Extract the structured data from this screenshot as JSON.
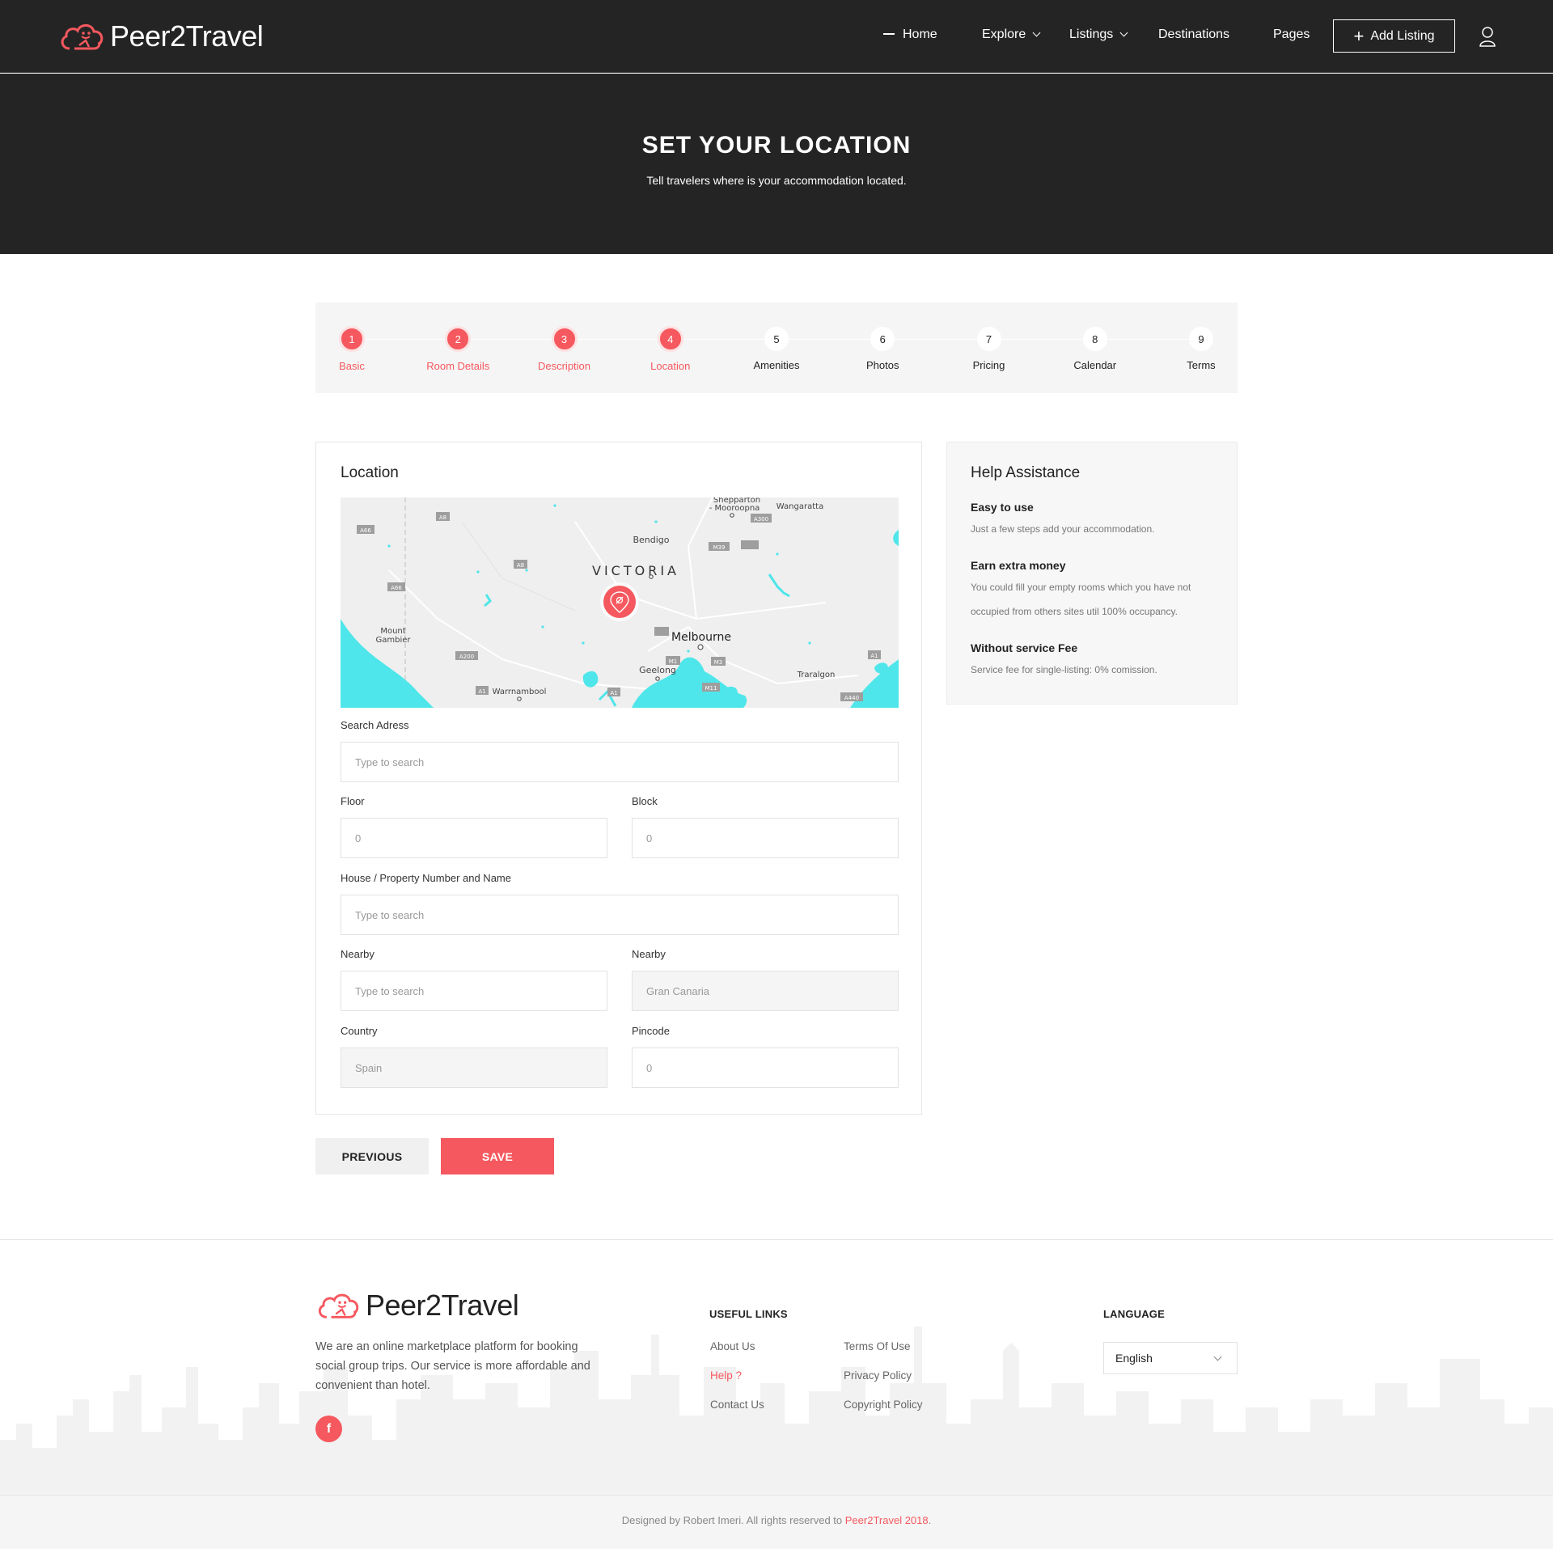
{
  "brand": {
    "name": "Peer2Travel",
    "accent": "#f5585e",
    "dark": "#242424"
  },
  "nav": {
    "home": "Home",
    "explore": "Explore",
    "listings": "Listings",
    "destinations": "Destinations",
    "pages": "Pages",
    "add_listing": "Add Listing"
  },
  "hero": {
    "title": "SET YOUR LOCATION",
    "subtitle": "Tell travelers where is your accommodation located."
  },
  "steps": [
    {
      "num": "1",
      "label": "Basic",
      "done": true
    },
    {
      "num": "2",
      "label": "Room Details",
      "done": true
    },
    {
      "num": "3",
      "label": "Description",
      "done": true
    },
    {
      "num": "4",
      "label": "Location",
      "done": true
    },
    {
      "num": "5",
      "label": "Amenities",
      "done": false
    },
    {
      "num": "6",
      "label": "Photos",
      "done": false
    },
    {
      "num": "7",
      "label": "Pricing",
      "done": false
    },
    {
      "num": "8",
      "label": "Calendar",
      "done": false
    },
    {
      "num": "9",
      "label": "Terms",
      "done": false
    }
  ],
  "location": {
    "title": "Location",
    "map": {
      "region": "VICTORIA",
      "places": [
        "Shepparton",
        "- Mooroopna",
        "Wangaratta",
        "Bendigo",
        "Melbourne",
        "Geelong",
        "Mount",
        "Gambier",
        "Warrnambool",
        "Traralgon"
      ],
      "roads": [
        "A66",
        "A8",
        "A8",
        "A66",
        "A300",
        "M39",
        "A200",
        "A1",
        "A1",
        "M1",
        "M3",
        "M11",
        "A1",
        "A440"
      ]
    },
    "fields": {
      "search_label": "Search Adress",
      "search_placeholder": "Type to search",
      "floor_label": "Floor",
      "floor_value": "0",
      "block_label": "Block",
      "block_value": "0",
      "house_label": "House / Property Number and Name",
      "house_placeholder": "Type to search",
      "nearby_label_1": "Nearby",
      "nearby_placeholder_1": "Type to search",
      "nearby_label_2": "Nearby",
      "nearby_value_2": "Gran Canaria",
      "country_label": "Country",
      "country_value": "Spain",
      "pincode_label": "Pincode",
      "pincode_value": "0"
    },
    "buttons": {
      "previous": "PREVIOUS",
      "save": "SAVE"
    }
  },
  "help": {
    "title": "Help Assistance",
    "items": [
      {
        "heading": "Easy to use",
        "text": "Just a few steps add your accommodation."
      },
      {
        "heading": "Earn extra money",
        "text": "You could fill your empty rooms which you have not occupied from others sites util 100% occupancy."
      },
      {
        "heading": "Without service Fee",
        "text": "Service fee for single-listing: 0% comission."
      }
    ]
  },
  "footer": {
    "brand": "Peer2Travel",
    "about": "We are an online marketplace platform for booking social group trips. Our service is more affordable and convenient than hotel.",
    "facebook": "f",
    "useful_links_title": "USEFUL LINKS",
    "links_col1": [
      "About Us",
      "Help ?",
      "Contact Us"
    ],
    "links_col2": [
      "Terms Of Use",
      "Privacy Policy",
      "Copyright Policy"
    ],
    "language_title": "LANGUAGE",
    "language_value": "English",
    "copyright_prefix": "Designed by Robert Imeri. All rights reserved to ",
    "copyright_accent": "Peer2Travel 2018",
    "copyright_suffix": "."
  }
}
